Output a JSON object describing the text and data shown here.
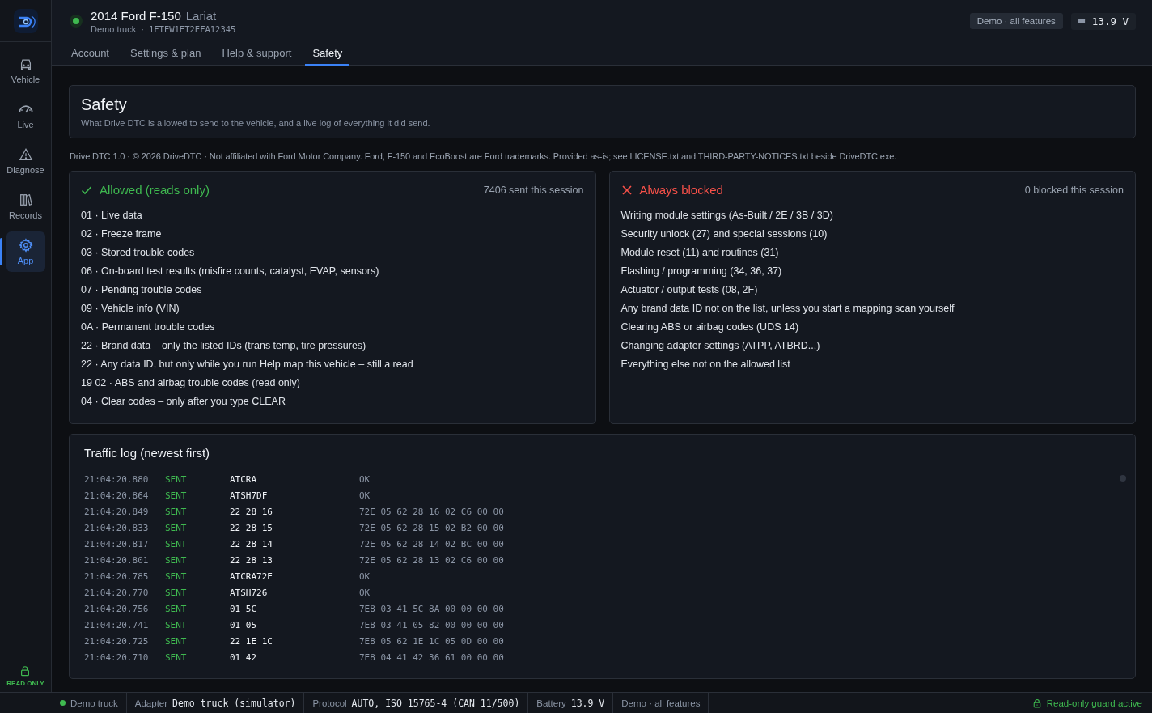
{
  "sidebar": {
    "items": [
      {
        "label": "Vehicle",
        "kind": "car",
        "selected": false
      },
      {
        "label": "Live",
        "kind": "gauge",
        "selected": false
      },
      {
        "label": "Diagnose",
        "kind": "warning",
        "selected": false
      },
      {
        "label": "Records",
        "kind": "books",
        "selected": false
      },
      {
        "label": "App",
        "kind": "gear",
        "selected": true
      }
    ],
    "footer": "READ ONLY"
  },
  "header": {
    "connected": true,
    "title": "2014 Ford F-150",
    "trim": "Lariat",
    "subtitle": "Demo truck",
    "separator": "·",
    "vin": "1FTEW1ET2EFA12345",
    "badge": "Demo · all features",
    "voltage": "13.9 V"
  },
  "tabs": [
    {
      "label": "Account",
      "selected": false
    },
    {
      "label": "Settings & plan",
      "selected": false
    },
    {
      "label": "Help & support",
      "selected": false
    },
    {
      "label": "Safety",
      "selected": true
    }
  ],
  "page": {
    "title": "Safety",
    "subtitle": "What Drive DTC is allowed to send to the vehicle, and a live log of everything it did send.",
    "notice": "Drive DTC 1.0 · © 2026 DriveDTC · Not affiliated with Ford Motor Company. Ford, F-150 and EcoBoost are Ford trademarks. Provided as-is; see LICENSE.txt and THIRD-PARTY-NOTICES.txt beside DriveDTC.exe."
  },
  "panels": [
    {
      "kind": "allowed",
      "title": "Allowed (reads only)",
      "count": "7406 sent this session",
      "items": [
        "01 · Live data",
        "02 · Freeze frame",
        "03 · Stored trouble codes",
        "06 · On-board test results (misfire counts, catalyst, EVAP, sensors)",
        "07 · Pending trouble codes",
        "09 · Vehicle info (VIN)",
        "0A · Permanent trouble codes",
        "22 · Brand data – only the listed IDs (trans temp, tire pressures)",
        "22 · Any data ID, but only while you run Help map this vehicle – still a read",
        "19 02 · ABS and airbag trouble codes (read only)",
        "04 · Clear codes – only after you type CLEAR"
      ]
    },
    {
      "kind": "blocked",
      "title": "Always blocked",
      "count": "0 blocked this session",
      "items": [
        "Writing module settings (As-Built / 2E / 3B / 3D)",
        "Security unlock (27) and special sessions (10)",
        "Module reset (11) and routines (31)",
        "Flashing / programming (34, 36, 37)",
        "Actuator / output tests (08, 2F)",
        "Any brand data ID not on the list, unless you start a mapping scan yourself",
        "Clearing ABS or airbag codes (UDS 14)",
        "Changing adapter settings (ATPP, ATBRD...)",
        "Everything else not on the allowed list"
      ]
    }
  ],
  "traffic_log": {
    "title": "Traffic log (newest first)",
    "rows": [
      {
        "time": "21:04:20.880",
        "kind": "sent",
        "status": "SENT",
        "command": "ATCRA",
        "response": "OK"
      },
      {
        "time": "21:04:20.864",
        "kind": "sent",
        "status": "SENT",
        "command": "ATSH7DF",
        "response": "OK"
      },
      {
        "time": "21:04:20.849",
        "kind": "sent",
        "status": "SENT",
        "command": "22 28 16",
        "response": "72E 05 62 28 16 02 C6 00 00"
      },
      {
        "time": "21:04:20.833",
        "kind": "sent",
        "status": "SENT",
        "command": "22 28 15",
        "response": "72E 05 62 28 15 02 B2 00 00"
      },
      {
        "time": "21:04:20.817",
        "kind": "sent",
        "status": "SENT",
        "command": "22 28 14",
        "response": "72E 05 62 28 14 02 BC 00 00"
      },
      {
        "time": "21:04:20.801",
        "kind": "sent",
        "status": "SENT",
        "command": "22 28 13",
        "response": "72E 05 62 28 13 02 C6 00 00"
      },
      {
        "time": "21:04:20.785",
        "kind": "sent",
        "status": "SENT",
        "command": "ATCRA72E",
        "response": "OK"
      },
      {
        "time": "21:04:20.770",
        "kind": "sent",
        "status": "SENT",
        "command": "ATSH726",
        "response": "OK"
      },
      {
        "time": "21:04:20.756",
        "kind": "sent",
        "status": "SENT",
        "command": "01 5C",
        "response": "7E8 03 41 5C 8A 00 00 00 00"
      },
      {
        "time": "21:04:20.741",
        "kind": "sent",
        "status": "SENT",
        "command": "01 05",
        "response": "7E8 03 41 05 82 00 00 00 00"
      },
      {
        "time": "21:04:20.725",
        "kind": "sent",
        "status": "SENT",
        "command": "22 1E 1C",
        "response": "7E8 05 62 1E 1C 05 0D 00 00"
      },
      {
        "time": "21:04:20.710",
        "kind": "sent",
        "status": "SENT",
        "command": "01 42",
        "response": "7E8 04 41 42 36 61 00 00 00"
      }
    ]
  },
  "status_bar": {
    "connected": true,
    "vehicle": "Demo truck",
    "fields": [
      {
        "label": "Adapter",
        "value": "Demo truck (simulator)"
      },
      {
        "label": "Protocol",
        "value": "AUTO, ISO 15765-4 (CAN 11/500)"
      },
      {
        "label": "Battery",
        "value": "13.9 V"
      }
    ],
    "plan": "Demo · all features",
    "guard": "Read-only guard active"
  }
}
